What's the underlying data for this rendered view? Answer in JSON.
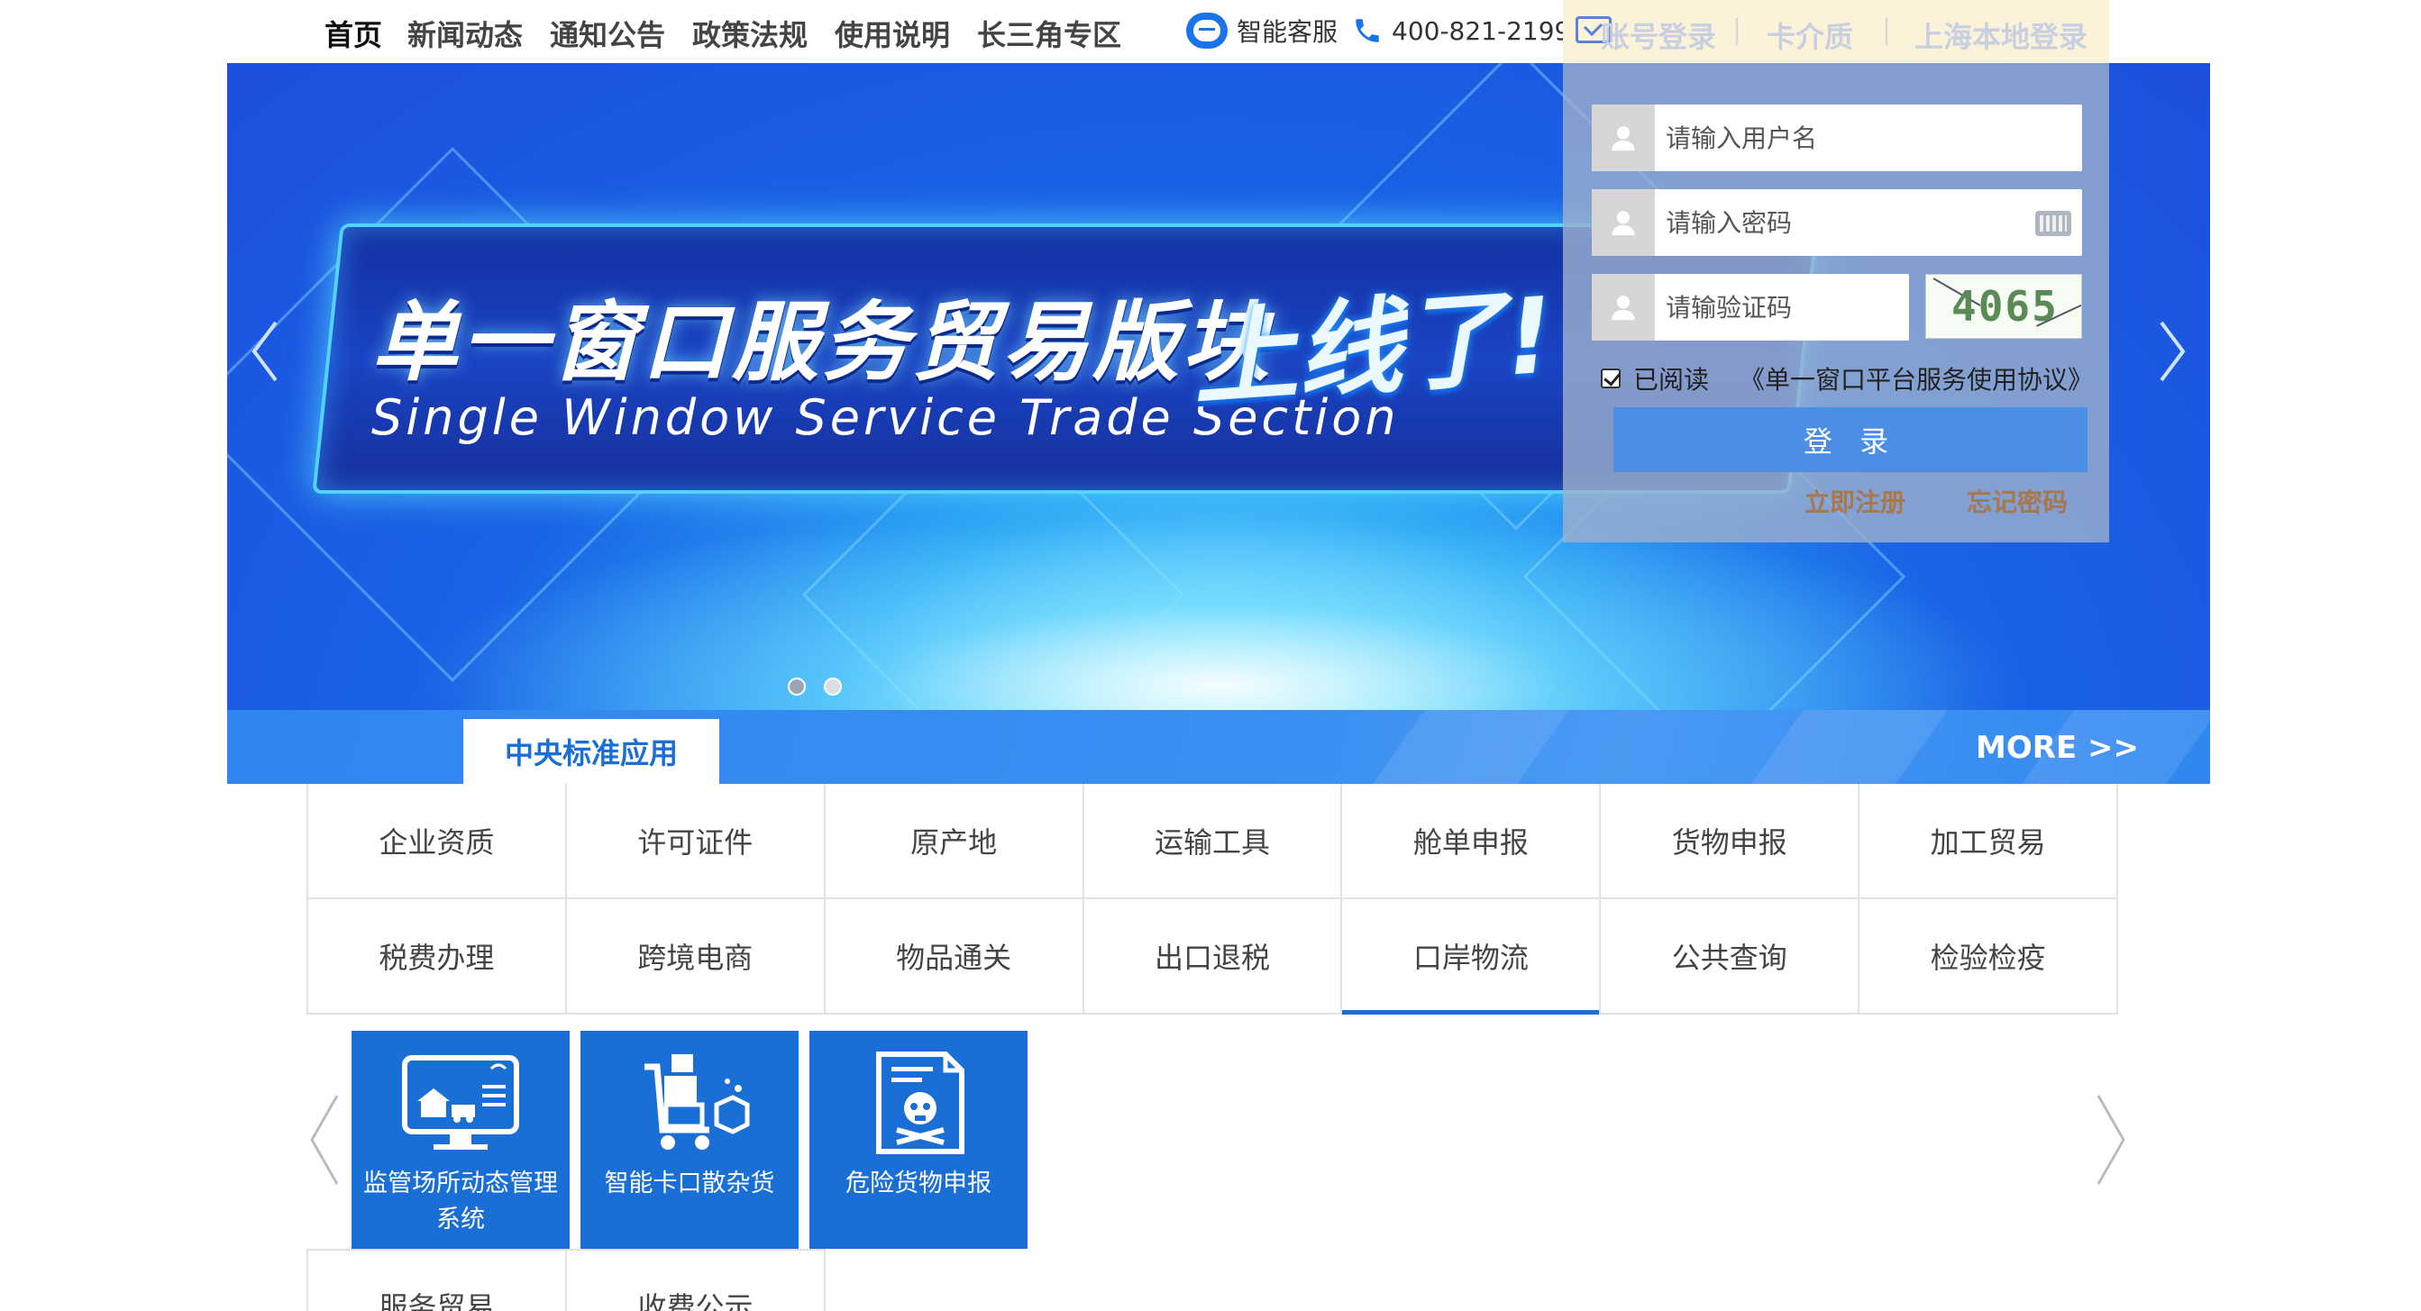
{
  "nav": {
    "items": [
      "首页",
      "新闻动态",
      "通知公告",
      "政策法规",
      "使用说明",
      "长三角专区"
    ],
    "service_label": "智能客服",
    "phone": "400-821-2199"
  },
  "login_tabs": {
    "account": "账号登录",
    "card": "卡介质",
    "local": "上海本地登录"
  },
  "banner": {
    "title_cn": "单一窗口服务贸易版块",
    "title_en": "Single Window Service Trade Section",
    "slogan": "上线了!"
  },
  "login": {
    "username_placeholder": "请输入用户名",
    "password_placeholder": "请输入密码",
    "captcha_placeholder": "请输验证码",
    "captcha_text": "4065",
    "agree_label": "已阅读",
    "agreement_link": "《单一窗口平台服务使用协议》",
    "submit": "登 录",
    "register": "立即注册",
    "forgot": "忘记密码"
  },
  "section": {
    "tab": "中央标准应用",
    "more": "MORE >>"
  },
  "categories": {
    "row1": [
      "企业资质",
      "许可证件",
      "原产地",
      "运输工具",
      "舱单申报",
      "货物申报",
      "加工贸易"
    ],
    "row2": [
      "税费办理",
      "跨境电商",
      "物品通关",
      "出口退税",
      "口岸物流",
      "公共查询",
      "检验检疫"
    ],
    "active": "口岸物流"
  },
  "apps": [
    {
      "label": "监管场所动态管理系统",
      "icon": "monitor-warehouse-icon"
    },
    {
      "label": "智能卡口散杂货",
      "icon": "cargo-trolley-icon"
    },
    {
      "label": "危险货物申报",
      "icon": "hazard-document-icon"
    }
  ],
  "bottom": [
    "服务贸易",
    "收费公示"
  ],
  "colors": {
    "primary": "#1a6fd6",
    "section_bar": "#3b90f2",
    "link_brown": "#a8774a"
  }
}
